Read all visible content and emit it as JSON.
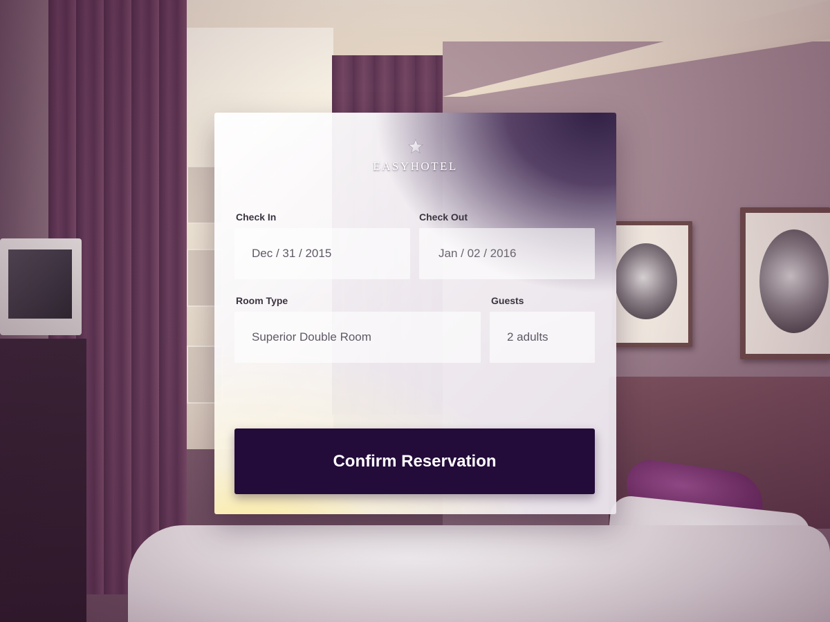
{
  "brand": {
    "name": "EASYHOTEL",
    "icon": "star-icon"
  },
  "form": {
    "check_in": {
      "label": "Check In",
      "value": "Dec / 31 / 2015"
    },
    "check_out": {
      "label": "Check Out",
      "value": "Jan / 02 / 2016"
    },
    "room_type": {
      "label": "Room Type",
      "value": "Superior Double Room"
    },
    "guests": {
      "label": "Guests",
      "value": "2 adults"
    }
  },
  "actions": {
    "confirm_label": "Confirm Reservation"
  },
  "colors": {
    "button_bg": "#230b3a",
    "button_text": "#ffffff",
    "label_text": "#3a3340",
    "field_text": "#5f5866",
    "curtain": "#5a3350"
  }
}
